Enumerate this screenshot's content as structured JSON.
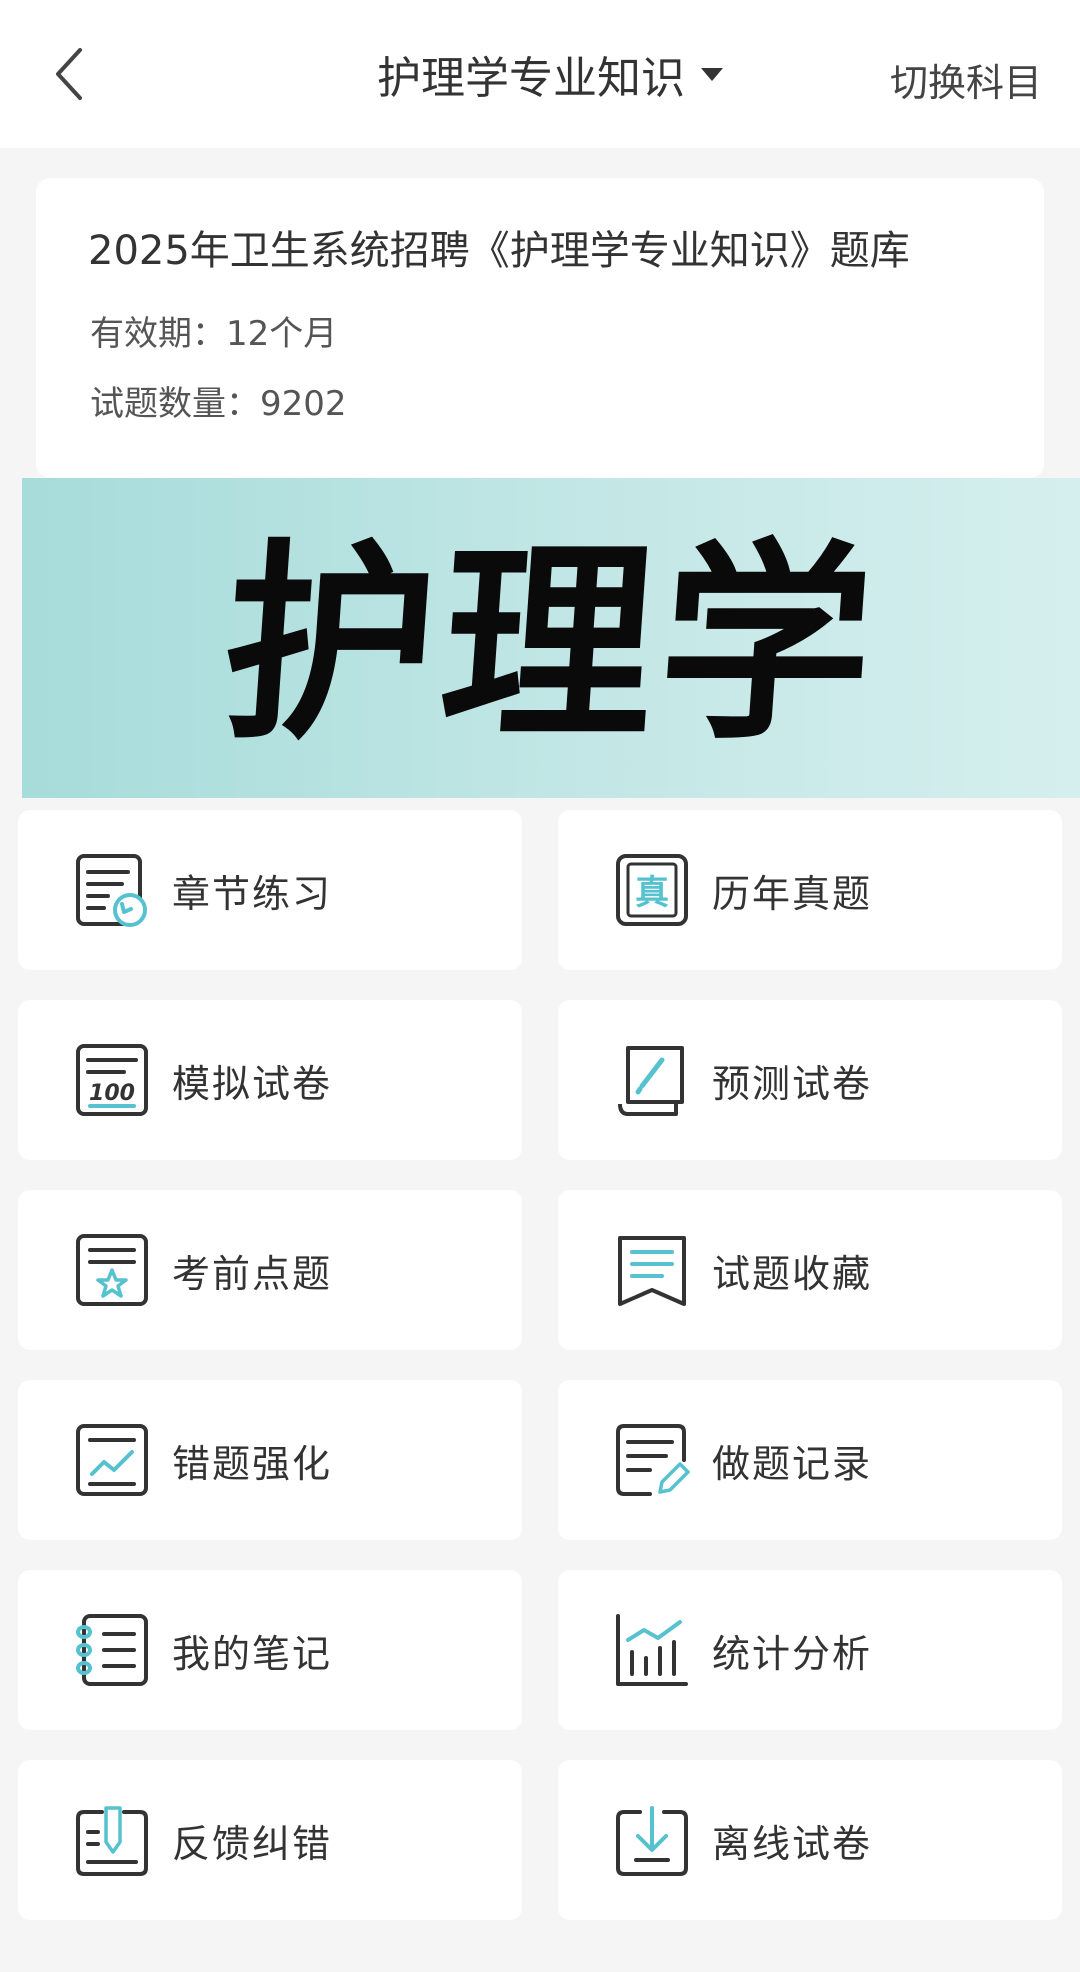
{
  "header": {
    "title": "护理学专业知识",
    "switch_label": "切换科目"
  },
  "info": {
    "title": "2025年卫生系统招聘《护理学专业知识》题库",
    "validity": "有效期：12个月",
    "question_count": "试题数量：9202"
  },
  "banner": {
    "text": "护理学"
  },
  "menu": [
    {
      "label": "章节练习",
      "icon": "chapter-practice-icon"
    },
    {
      "label": "历年真题",
      "icon": "past-exams-icon"
    },
    {
      "label": "模拟试卷",
      "icon": "mock-exam-icon"
    },
    {
      "label": "预测试卷",
      "icon": "prediction-exam-icon"
    },
    {
      "label": "考前点题",
      "icon": "key-points-icon"
    },
    {
      "label": "试题收藏",
      "icon": "bookmark-icon"
    },
    {
      "label": "错题强化",
      "icon": "wrong-questions-icon"
    },
    {
      "label": "做题记录",
      "icon": "record-icon"
    },
    {
      "label": "我的笔记",
      "icon": "notes-icon"
    },
    {
      "label": "统计分析",
      "icon": "statistics-icon"
    },
    {
      "label": "反馈纠错",
      "icon": "feedback-icon"
    },
    {
      "label": "离线试卷",
      "icon": "download-icon"
    }
  ],
  "colors": {
    "accent": "#56c2cf",
    "icon_stroke": "#333333",
    "banner_start": "#a6dcda",
    "banner_end": "#d5efee"
  }
}
